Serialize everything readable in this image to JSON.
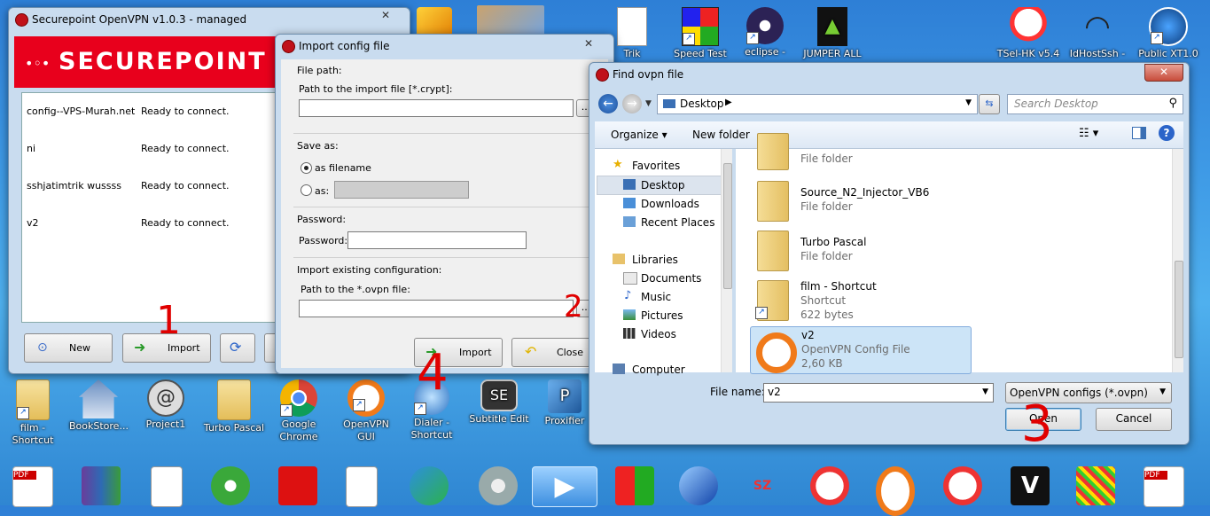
{
  "desktop": {
    "top_icons": [
      {
        "label": "Trik"
      },
      {
        "label": "Speed Test"
      },
      {
        "label": "eclipse -"
      },
      {
        "label": "JUMPER ALL"
      },
      {
        "label": "TSel-HK v5.4"
      },
      {
        "label": "IdHostSsh -"
      },
      {
        "label": "Public XT1.0"
      }
    ],
    "bottom_icons": [
      {
        "label": "film - Shortcut"
      },
      {
        "label": "BookStore..."
      },
      {
        "label": "Project1"
      },
      {
        "label": "Turbo Pascal"
      },
      {
        "label": "Google Chrome"
      },
      {
        "label": "OpenVPN GUI"
      },
      {
        "label": "Dialer - Shortcut"
      },
      {
        "label": "Subtitle Edit"
      },
      {
        "label": "Proxifier"
      }
    ]
  },
  "securepoint": {
    "title": "Securepoint OpenVPN v1.0.3 - managed",
    "logo_text": "SECUREPOINT",
    "connections": [
      {
        "name": "config--VPS-Murah.net",
        "status": "Ready to connect."
      },
      {
        "name": "ni",
        "status": "Ready to connect."
      },
      {
        "name": "sshjatimtrik wussss",
        "status": "Ready to connect."
      },
      {
        "name": "v2",
        "status": "Ready to connect."
      }
    ],
    "buttons": {
      "new": "New",
      "import": "Import"
    }
  },
  "import_dialog": {
    "title": "Import config file",
    "file_path_heading": "File path:",
    "file_path_label": "Path to the import file [*.crypt]:",
    "browse_label": "...",
    "save_as_heading": "Save as:",
    "as_filename": "as filename",
    "as_label": "as:",
    "password_heading": "Password:",
    "password_label": "Password:",
    "import_existing_heading": "Import existing configuration:",
    "ovpn_path_label": "Path to the *.ovpn file:",
    "import_button": "Import",
    "close_button": "Close"
  },
  "find_dialog": {
    "title": "Find ovpn file",
    "location": "Desktop",
    "search_placeholder": "Search Desktop",
    "organize": "Organize",
    "new_folder": "New folder",
    "nav": {
      "favorites": "Favorites",
      "desktop": "Desktop",
      "downloads": "Downloads",
      "recent_places": "Recent Places",
      "libraries": "Libraries",
      "documents": "Documents",
      "music": "Music",
      "pictures": "Pictures",
      "videos": "Videos",
      "computer": "Computer"
    },
    "files": [
      {
        "name": "",
        "sub": "File folder"
      },
      {
        "name": "Source_N2_Injector_VB6",
        "sub": "File folder"
      },
      {
        "name": "Turbo Pascal",
        "sub": "File folder"
      },
      {
        "name": "film - Shortcut",
        "sub": "Shortcut",
        "sub2": "622 bytes"
      },
      {
        "name": "v2",
        "sub": "OpenVPN Config File",
        "sub2": "2,60 KB"
      }
    ],
    "file_name_label": "File name:",
    "file_name_value": "v2",
    "file_type": "OpenVPN configs (*.ovpn)",
    "open_button": "Open",
    "cancel_button": "Cancel"
  },
  "annotations": {
    "one": "1",
    "two": "2",
    "three": "3",
    "four": "4"
  },
  "colors": {
    "brand_red": "#e8001c",
    "selection": "#cce4f7",
    "title_bg": "#c9dcef"
  }
}
